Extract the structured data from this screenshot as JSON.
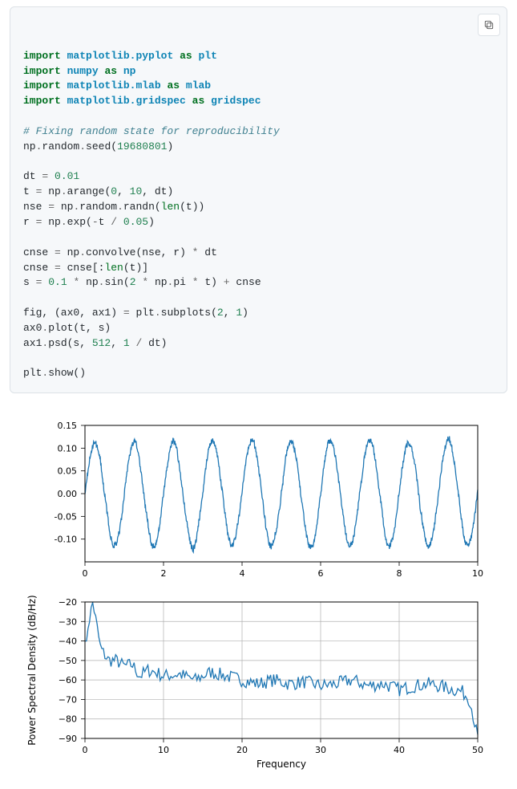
{
  "code": {
    "l1a": "import",
    "l1b": "matplotlib.pyplot",
    "l1c": "as",
    "l1d": "plt",
    "l2a": "import",
    "l2b": "numpy",
    "l2c": "as",
    "l2d": "np",
    "l3a": "import",
    "l3b": "matplotlib.mlab",
    "l3c": "as",
    "l3d": "mlab",
    "l4a": "import",
    "l4b": "matplotlib.gridspec",
    "l4c": "as",
    "l4d": "gridspec",
    "l6": "# Fixing random state for reproducibility",
    "l7a": "np",
    "l7b": ".",
    "l7c": "random",
    "l7d": ".",
    "l7e": "seed(",
    "l7f": "19680801",
    "l7g": ")",
    "l9a": "dt ",
    "l9b": "=",
    "l9c": " ",
    "l9d": "0.01",
    "l10a": "t ",
    "l10b": "=",
    "l10c": " np",
    "l10d": ".",
    "l10e": "arange(",
    "l10f": "0",
    "l10g": ", ",
    "l10h": "10",
    "l10i": ", dt)",
    "l11a": "nse ",
    "l11b": "=",
    "l11c": " np",
    "l11d": ".",
    "l11e": "random",
    "l11f": ".",
    "l11g": "randn(",
    "l11h": "len",
    "l11i": "(t))",
    "l12a": "r ",
    "l12b": "=",
    "l12c": " np",
    "l12d": ".",
    "l12e": "exp(",
    "l12f": "-",
    "l12g": "t ",
    "l12h": "/",
    "l12i": " ",
    "l12j": "0.05",
    "l12k": ")",
    "l14a": "cnse ",
    "l14b": "=",
    "l14c": " np",
    "l14d": ".",
    "l14e": "convolve(nse, r) ",
    "l14f": "*",
    "l14g": " dt",
    "l15a": "cnse ",
    "l15b": "=",
    "l15c": " cnse[:",
    "l15d": "len",
    "l15e": "(t)]",
    "l16a": "s ",
    "l16b": "=",
    "l16c": " ",
    "l16d": "0.1",
    "l16e": " ",
    "l16f": "*",
    "l16g": " np",
    "l16h": ".",
    "l16i": "sin(",
    "l16j": "2",
    "l16k": " ",
    "l16l": "*",
    "l16m": " np",
    "l16n": ".",
    "l16o": "pi ",
    "l16p": "*",
    "l16q": " t) ",
    "l16r": "+",
    "l16s": " cnse",
    "l18a": "fig, (ax0, ax1) ",
    "l18b": "=",
    "l18c": " plt",
    "l18d": ".",
    "l18e": "subplots(",
    "l18f": "2",
    "l18g": ", ",
    "l18h": "1",
    "l18i": ")",
    "l19a": "ax0",
    "l19b": ".",
    "l19c": "plot(t, s)",
    "l20a": "ax1",
    "l20b": ".",
    "l20c": "psd(s, ",
    "l20d": "512",
    "l20e": ", ",
    "l20f": "1",
    "l20g": " ",
    "l20h": "/",
    "l20i": " dt)",
    "l22a": "plt",
    "l22b": ".",
    "l22c": "show()"
  },
  "chart_data": [
    {
      "type": "line",
      "title": "",
      "xlabel": "",
      "ylabel": "",
      "xlim": [
        0,
        10
      ],
      "ylim": [
        -0.15,
        0.15
      ],
      "xticks": [
        0,
        2,
        4,
        6,
        8,
        10
      ],
      "yticks": [
        -0.1,
        -0.05,
        0.0,
        0.05,
        0.1,
        0.15
      ],
      "description": "noisy sine signal s(t)=0.1*sin(2*pi*t)+colored_noise, period 1, amplitude approx 0.12",
      "series": [
        {
          "name": "s",
          "note": "1000 points from t=0 to 10 step 0.01; values oscillate roughly between -0.13 and 0.14 with period 1"
        }
      ]
    },
    {
      "type": "line",
      "title": "",
      "xlabel": "Frequency",
      "ylabel": "Power Spectral Density (dB/Hz)",
      "xlim": [
        0,
        50
      ],
      "ylim": [
        -90,
        -20
      ],
      "xticks": [
        0,
        10,
        20,
        30,
        40,
        50
      ],
      "yticks": [
        -90,
        -80,
        -70,
        -60,
        -50,
        -40,
        -30,
        -20
      ],
      "grid": true,
      "series": [
        {
          "name": "PSD",
          "freq": [
            0,
            1,
            2,
            3,
            4,
            5,
            6,
            7,
            8,
            9,
            10,
            12,
            14,
            16,
            18,
            20,
            22,
            24,
            26,
            28,
            30,
            32,
            34,
            36,
            38,
            40,
            42,
            44,
            46,
            48,
            49,
            50
          ],
          "db": [
            -40,
            -20,
            -44,
            -50,
            -50,
            -53,
            -52,
            -58,
            -55,
            -56,
            -58,
            -57,
            -60,
            -56,
            -58,
            -60,
            -62,
            -60,
            -62,
            -61,
            -63,
            -62,
            -60,
            -63,
            -62,
            -65,
            -63,
            -62,
            -64,
            -66,
            -70,
            -90
          ]
        }
      ]
    }
  ]
}
